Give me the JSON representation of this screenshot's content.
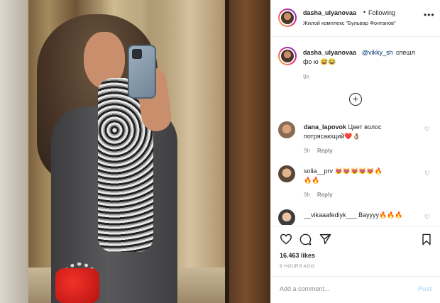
{
  "post": {
    "username": "dasha_ulyanovaa",
    "separator": "•",
    "follow_status": "Following",
    "location": "Жилой комплекс \"Бульвар Фонтанов\"",
    "more_icon": "more-horizontal-icon"
  },
  "caption": {
    "username": "dasha_ulyanovaa",
    "mention": "@vikky_sh",
    "text_part1": "спешл",
    "text_part2": "фо ю 😅😂",
    "time": "9h"
  },
  "load_more_icon": "plus-circle-icon",
  "comments": [
    {
      "username": "dana_lapovok",
      "text_part1": "Цвет волос",
      "text_part2": "потрясающий❤️👌🏽",
      "time": "9h",
      "reply": "Reply"
    },
    {
      "username": "solia__prv",
      "text_part1": "😻😻😻😻😻🔥",
      "text_part2": "🔥🔥",
      "time": "9h",
      "reply": "Reply"
    },
    {
      "username": "__vikaaafediyk___",
      "text_part1": "Вауууу🔥🔥🔥"
    }
  ],
  "actions": {
    "like_icon": "heart-icon",
    "comment_icon": "comment-icon",
    "share_icon": "send-icon",
    "save_icon": "bookmark-icon"
  },
  "likes": "16.463 likes",
  "time_ago": "9 HOURS AGO",
  "add_comment": {
    "placeholder": "Add a comment...",
    "post_label": "Post"
  }
}
